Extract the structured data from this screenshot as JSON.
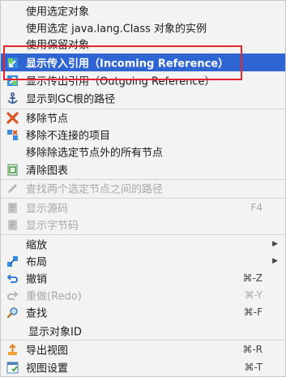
{
  "colors": {
    "selection": "#2f65d3",
    "highlight_box": "#e2262c"
  },
  "items": [
    {
      "label": "使用选定对象"
    },
    {
      "label": "使用选定 java.lang.Class 对象的实例"
    },
    {
      "label": "使用保留对象"
    },
    {
      "label": "显示传入引用（Incoming Reference）",
      "icon": "incoming-reference-icon"
    },
    {
      "label": "显示传出引用（Outgoing Reference）",
      "icon": "outgoing-reference-icon"
    },
    {
      "label": "显示到GC根的路径",
      "icon": "anchor-icon"
    },
    {
      "label": "移除节点",
      "icon": "remove-x-icon"
    },
    {
      "label": "移除不连接的项目",
      "icon": "remove-unconnected-icon"
    },
    {
      "label": "移除除选定节点外的所有节点"
    },
    {
      "label": "清除图表",
      "icon": "clear-chart-icon"
    },
    {
      "label": "查找两个选定节点之间的路径",
      "icon": "pencil-icon"
    },
    {
      "label": "显示源码",
      "icon": "source-file-icon",
      "shortcut": "F4"
    },
    {
      "label": "显示字节码",
      "icon": "bytecode-file-icon"
    },
    {
      "label": "缩放"
    },
    {
      "label": "布局",
      "icon": "layout-icon"
    },
    {
      "label": "撤销",
      "icon": "undo-icon",
      "shortcut": "⌘-Z"
    },
    {
      "label": "重做(Redo)",
      "icon": "redo-icon",
      "shortcut": "⌘-Y"
    },
    {
      "label": "查找",
      "icon": "magnifier-icon",
      "shortcut": "⌘-F"
    },
    {
      "label": "显示对象ID"
    },
    {
      "label": "导出视图",
      "icon": "export-icon",
      "shortcut": "⌘-R"
    },
    {
      "label": "视图设置",
      "icon": "view-settings-icon",
      "shortcut": "⌘-T"
    }
  ]
}
